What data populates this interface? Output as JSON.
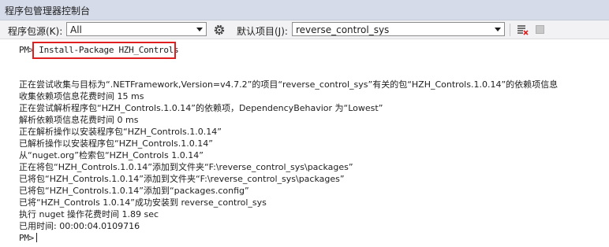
{
  "window": {
    "title": "程序包管理器控制台"
  },
  "toolbar": {
    "source_label": "程序包源(K):",
    "source_value": "All",
    "settings_icon": "gear-icon",
    "project_label": "默认项目(J):",
    "project_value": "reverse_control_sys",
    "clear_icon": "clear-console-icon",
    "stop_icon": "stop-icon"
  },
  "console": {
    "prompt": "PM>",
    "command": "Install-Package HZH_Controls",
    "lines": [
      "正在尝试收集与目标为“.NETFramework,Version=v4.7.2”的项目“reverse_control_sys”有关的包“HZH_Controls.1.0.14”的依赖项信息",
      "收集依赖项信息花费时间 15 ms",
      "正在尝试解析程序包“HZH_Controls.1.0.14”的依赖项，DependencyBehavior 为“Lowest”",
      "解析依赖项信息花费时间 0 ms",
      "正在解析操作以安装程序包“HZH_Controls.1.0.14”",
      "已解析操作以安装程序包“HZH_Controls.1.0.14”",
      "从“nuget.org”检索包“HZH_Controls 1.0.14”",
      "正在将包“HZH_Controls.1.0.14”添加到文件夹“F:\\reverse_control_sys\\packages”",
      "已将包“HZH_Controls.1.0.14”添加到文件夹“F:\\reverse_control_sys\\packages”",
      "已将包“HZH_Controls.1.0.14”添加到“packages.config”",
      "已将“HZH_Controls 1.0.14”成功安装到 reverse_control_sys",
      "执行 nuget 操作花费时间 1.89 sec",
      "已用时间: 00:00:04.0109716"
    ],
    "final_prompt": "PM>"
  },
  "colors": {
    "highlight_border": "#e02020",
    "titlebar": "#d6dbe9",
    "toolbar": "#f2f2f4"
  }
}
